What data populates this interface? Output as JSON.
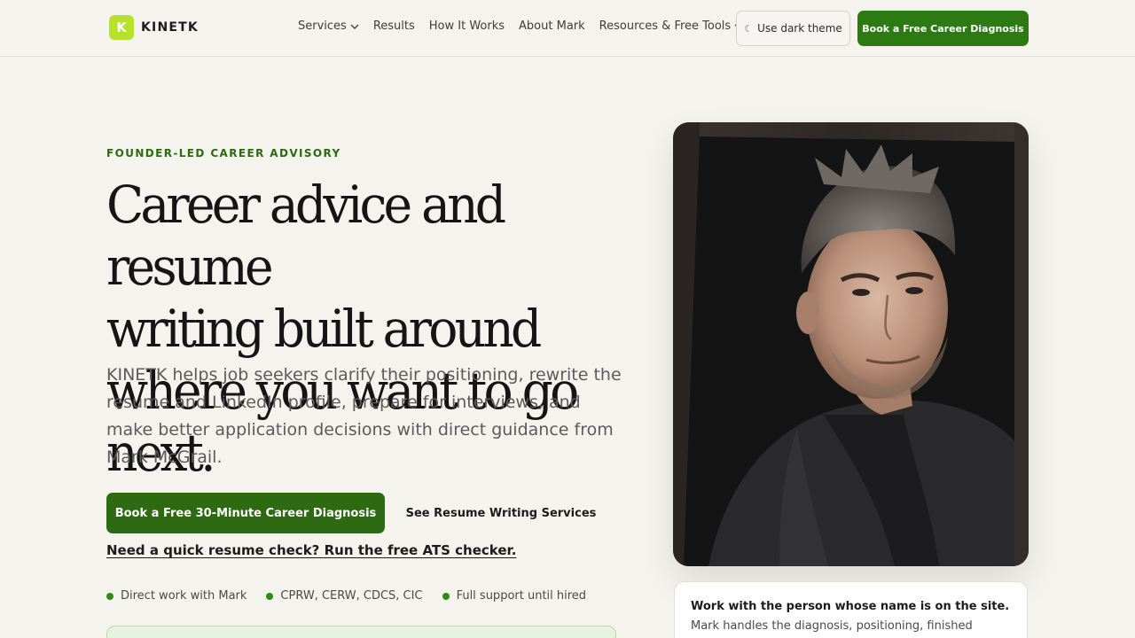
{
  "brand": {
    "logo_letter": "K",
    "name": "KINETK",
    "accent": "#b6e22e",
    "primary": "#2d6a12"
  },
  "nav": {
    "items": [
      {
        "label": "Services",
        "has_dropdown": true
      },
      {
        "label": "Results",
        "has_dropdown": false
      },
      {
        "label": "How It Works",
        "has_dropdown": false
      },
      {
        "label": "About Mark",
        "has_dropdown": false
      },
      {
        "label": "Resources & Free Tools",
        "has_dropdown": true
      }
    ],
    "theme_toggle": {
      "icon": "moon-icon",
      "glyph": "☾",
      "label": "Use dark theme"
    },
    "cta": "Book a Free Career Diagnosis"
  },
  "hero": {
    "eyebrow": "FOUNDER-LED CAREER ADVISORY",
    "headline_lines": [
      "Career advice and resume",
      "writing built around",
      "where you want to go next."
    ],
    "lede": "KINETK helps job seekers clarify their positioning, rewrite the resume and LinkedIn profile, prepare for interviews, and make better application decisions with direct guidance from Mark McGrail.",
    "primary_cta": "Book a Free 30-Minute Career Diagnosis",
    "secondary_cta": "See Resume Writing Services",
    "ats_link": "Need a quick resume check? Run the free ATS checker.",
    "proof_points": [
      "Direct work with Mark",
      "CPRW, CERW, CDCS, CIC",
      "Full support until hired"
    ]
  },
  "card": {
    "title": "Work with the person whose name is on the site.",
    "body": "Mark handles the diagnosis, positioning, finished"
  }
}
